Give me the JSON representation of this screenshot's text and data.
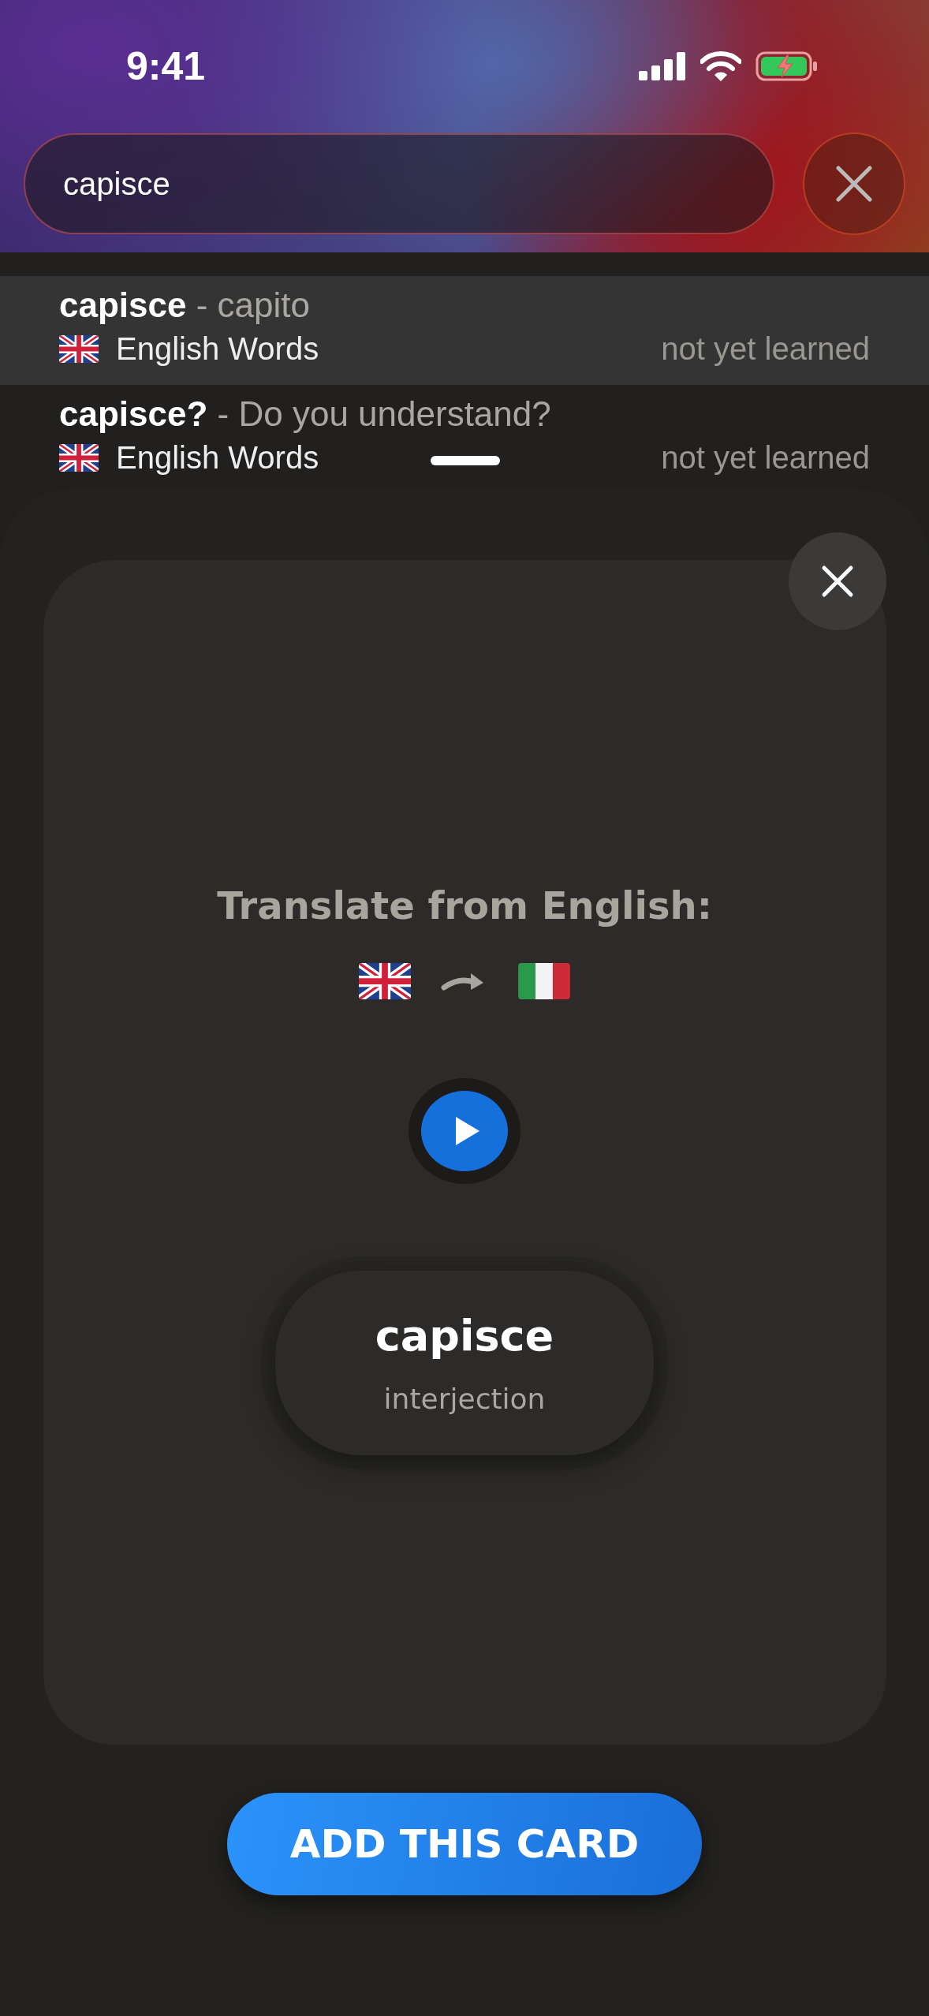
{
  "status_bar": {
    "time": "9:41"
  },
  "search": {
    "value": "capisce"
  },
  "results": [
    {
      "term": "capisce",
      "separator": "-",
      "translation": "capito",
      "deck": "English Words",
      "status": "not yet learned",
      "selected": true
    },
    {
      "term": "capisce?",
      "separator": "-",
      "translation": "Do you understand?",
      "deck": "English Words",
      "status": "not yet learned",
      "selected": false
    }
  ],
  "card": {
    "prompt": "Translate from English:",
    "word": "capisce",
    "part_of_speech": "interjection"
  },
  "add_button": {
    "label": "ADD THIS CARD"
  }
}
